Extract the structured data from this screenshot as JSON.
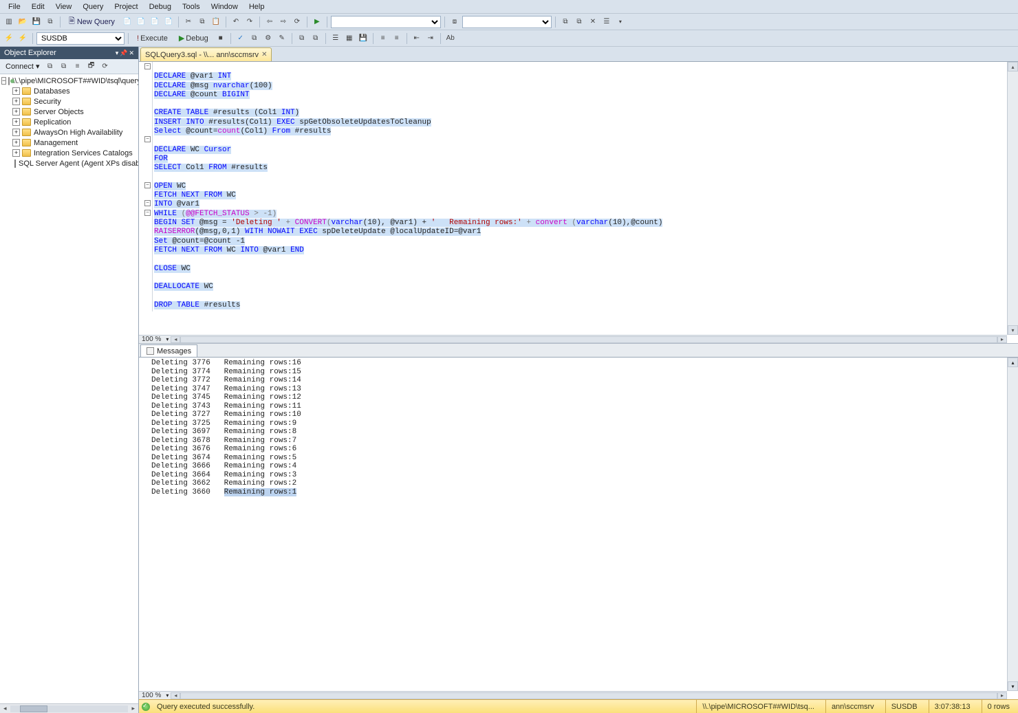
{
  "menu": [
    "File",
    "Edit",
    "View",
    "Query",
    "Project",
    "Debug",
    "Tools",
    "Window",
    "Help"
  ],
  "toolbar1": {
    "new_query": "New Query",
    "combo_right": ""
  },
  "toolbar2": {
    "db_combo": "SUSDB",
    "execute": "Execute",
    "debug": "Debug"
  },
  "objexp": {
    "title": "Object Explorer",
    "connect": "Connect",
    "root": "\\\\.\\pipe\\MICROSOFT##WID\\tsql\\query",
    "nodes": [
      "Databases",
      "Security",
      "Server Objects",
      "Replication",
      "AlwaysOn High Availability",
      "Management",
      "Integration Services Catalogs"
    ],
    "agent": "SQL Server Agent (Agent XPs disabl"
  },
  "tab": {
    "label": "SQLQuery3.sql - \\\\... ann\\sccmsrv"
  },
  "code": {
    "l1a": "DECLARE",
    "l1b": " @var1 ",
    "l1c": "INT",
    "l2a": "DECLARE",
    "l2b": " @msg ",
    "l2c": "nvarchar",
    "l2d": "(100)",
    "l3a": "DECLARE",
    "l3b": " @count ",
    "l3c": "BIGINT",
    "l5a": "CREATE TABLE",
    "l5b": " #results (Col1 ",
    "l5c": "INT",
    "l5d": ")",
    "l6a": "INSERT INTO",
    "l6b": " #results(Col1) ",
    "l6c": "EXEC",
    "l6d": " spGetObsoleteUpdatesToCleanup",
    "l7a": "Select",
    "l7b": " @count=",
    "l7c": "count",
    "l7d": "(Col1) ",
    "l7e": "From",
    "l7f": " #results",
    "l9a": "DECLARE",
    "l9b": " WC ",
    "l9c": "Cursor",
    "l10a": "FOR",
    "l11a": "SELECT",
    "l11b": " Col1 ",
    "l11c": "FROM",
    "l11d": " #results",
    "l13a": "OPEN",
    "l13b": " WC",
    "l14a": "FETCH NEXT FROM",
    "l14b": " WC",
    "l15a": "INTO",
    "l15b": " @var1",
    "l16a": "WHILE",
    "l16b": " (",
    "l16c": "@@FETCH_STATUS",
    "l16d": " > -1)",
    "l17a": "BEGIN SET",
    "l17b": " @msg = ",
    "l17c": "'Deleting '",
    "l17d": " + ",
    "l17e": "CONVERT",
    "l17f": "(",
    "l17g": "varchar",
    "l17h": "(10), @var1) + ",
    "l17i": "'   Remaining rows:'",
    "l17j": " + ",
    "l17k": "convert",
    "l17l": " (",
    "l17m": "varchar",
    "l17n": "(10),@count)",
    "l18a": "RAISERROR",
    "l18b": "(@msg,0,1) ",
    "l18c": "WITH NOWAIT EXEC",
    "l18d": " spDeleteUpdate @localUpdateID=@var1",
    "l19a": "Set",
    "l19b": " @count=@count -1",
    "l20a": "FETCH NEXT FROM",
    "l20b": " WC ",
    "l20c": "INTO",
    "l20d": " @var1 ",
    "l20e": "END",
    "l22a": "CLOSE",
    "l22b": " WC",
    "l24a": "DEALLOCATE",
    "l24b": " WC",
    "l26a": "DROP TABLE",
    "l26b": " #results"
  },
  "zoom": "100 %",
  "results_tab": "Messages",
  "messages": [
    {
      "id": "3776",
      "rem": "16"
    },
    {
      "id": "3774",
      "rem": "15"
    },
    {
      "id": "3772",
      "rem": "14"
    },
    {
      "id": "3747",
      "rem": "13"
    },
    {
      "id": "3745",
      "rem": "12"
    },
    {
      "id": "3743",
      "rem": "11"
    },
    {
      "id": "3727",
      "rem": "10"
    },
    {
      "id": "3725",
      "rem": "9"
    },
    {
      "id": "3697",
      "rem": "8"
    },
    {
      "id": "3678",
      "rem": "7"
    },
    {
      "id": "3676",
      "rem": "6"
    },
    {
      "id": "3674",
      "rem": "5"
    },
    {
      "id": "3666",
      "rem": "4"
    },
    {
      "id": "3664",
      "rem": "3"
    },
    {
      "id": "3662",
      "rem": "2"
    },
    {
      "id": "3660",
      "rem": "1"
    }
  ],
  "msg_prefix": "Deleting ",
  "msg_mid": "   Remaining rows:",
  "status": {
    "text": "Query executed successfully.",
    "server": "\\\\.\\pipe\\MICROSOFT##WID\\tsq...",
    "user": "ann\\sccmsrv",
    "db": "SUSDB",
    "elapsed": "3:07:38:13",
    "rows": "0 rows"
  }
}
